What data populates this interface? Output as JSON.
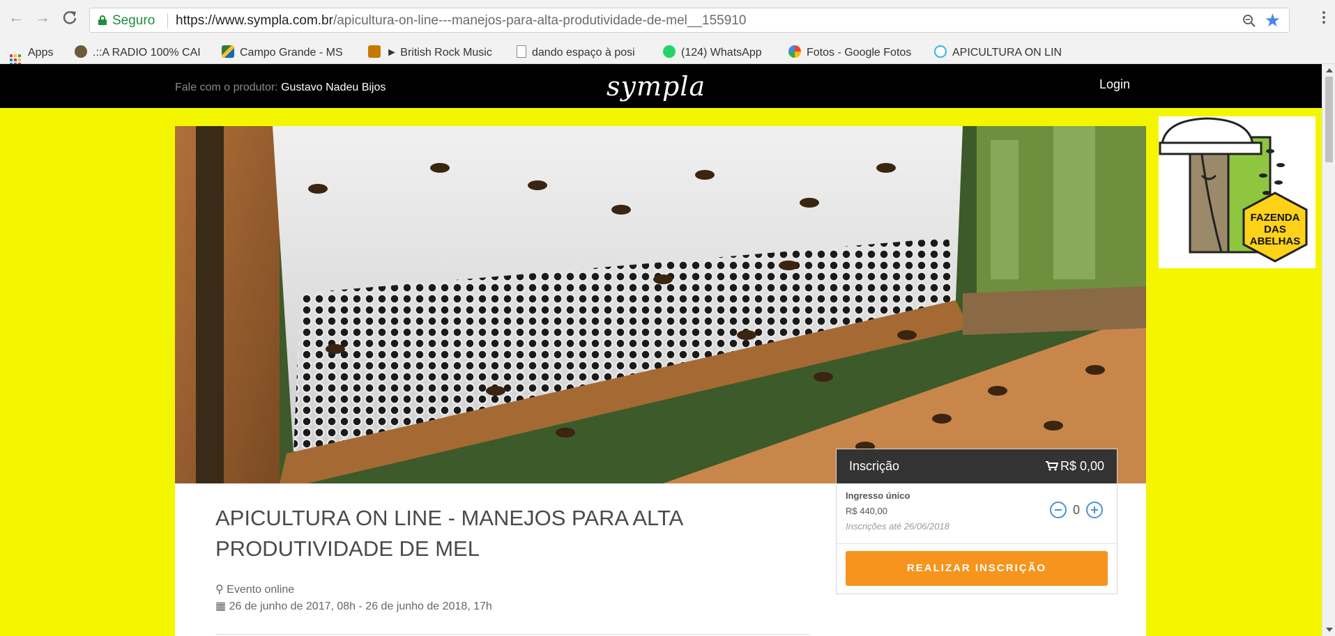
{
  "browser": {
    "secure_label": "Seguro",
    "url_host": "https://www.sympla.com.br",
    "url_path": "/apicultura-on-line---manejos-para-alta-produtividade-de-mel__155910",
    "bookmarks": [
      {
        "label": "Apps",
        "icon": "apps-grid-icon"
      },
      {
        "label": ".::A RADIO 100% CAI",
        "icon": "radio-icon"
      },
      {
        "label": "Campo Grande - MS",
        "icon": "bookmark-flag-icon"
      },
      {
        "label": "► British Rock Music",
        "icon": "music-icon"
      },
      {
        "label": "dando espaço à posi",
        "icon": "page-icon"
      },
      {
        "label": "(124) WhatsApp",
        "icon": "whatsapp-icon"
      },
      {
        "label": "Fotos - Google Fotos",
        "icon": "google-photos-icon"
      },
      {
        "label": "APICULTURA ON LIN",
        "icon": "sympla-icon"
      }
    ]
  },
  "header": {
    "contact_prefix": "Fale com o produtor:",
    "producer_name": "Gustavo Nadeu Bijos",
    "logo": "sympla",
    "login_label": "Login"
  },
  "event": {
    "title": "APICULTURA ON LINE - MANEJOS PARA ALTA PRODUTIVIDADE DE MEL",
    "location": "Evento online",
    "date_range": "26 de junho de 2017, 08h - 26 de junho de 2018, 17h"
  },
  "ticket": {
    "header_label": "Inscrição",
    "cart_total": "R$ 0,00",
    "name": "Ingresso único",
    "price": "R$ 440,00",
    "until": "Inscrições até 26/06/2018",
    "quantity": "0",
    "button_label": "REALIZAR INSCRIÇÃO"
  },
  "side_logo": {
    "line1": "FAZENDA",
    "line2": "DAS",
    "line3": "ABELHAS"
  },
  "colors": {
    "page_bg": "#f4f600",
    "header_bg": "#000000",
    "button": "#f7941d",
    "qty_icons": "#4a90d9"
  }
}
